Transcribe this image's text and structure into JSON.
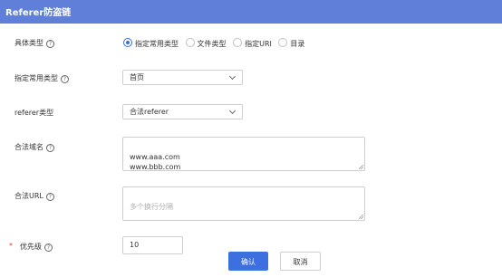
{
  "header": {
    "title": "Referer防盗链"
  },
  "fields": {
    "type": {
      "label": "具体类型",
      "options": [
        {
          "label": "指定常用类型",
          "checked": true
        },
        {
          "label": "文件类型",
          "checked": false
        },
        {
          "label": "指定URI",
          "checked": false
        },
        {
          "label": "目录",
          "checked": false
        }
      ]
    },
    "common_type": {
      "label": "指定常用类型",
      "value": "首页"
    },
    "referer_type": {
      "label": "referer类型",
      "value": "合法referer"
    },
    "domains": {
      "label": "合法域名",
      "value": "www.aaa.com\nwww.bbb.com"
    },
    "urls": {
      "label": "合法URL",
      "placeholder": "多个换行分隔"
    },
    "priority": {
      "label": "优先级",
      "value": "10",
      "required_mark": "*"
    }
  },
  "help_glyph": "?",
  "footer": {
    "confirm_label": "确认",
    "cancel_label": "取消"
  },
  "colors": {
    "header": "#5f7fd8",
    "accent": "#3e6fe0",
    "required": "#e04545"
  }
}
